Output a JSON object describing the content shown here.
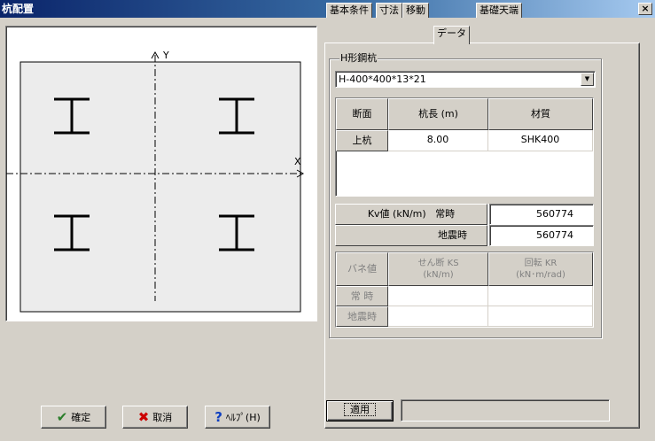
{
  "window": {
    "title": "杭配置",
    "close_glyph": "×"
  },
  "canvas": {
    "axis_y_label": "Y",
    "axis_x_label": "X",
    "background": "#ececec",
    "piles": [
      "I",
      "I",
      "I",
      "I"
    ]
  },
  "tabs": [
    {
      "label": "基本条件",
      "active": false
    },
    {
      "label": "寸法",
      "active": false
    },
    {
      "label": "移動",
      "active": false
    },
    {
      "label": "データ",
      "active": true
    },
    {
      "label": "基礎天端",
      "active": false
    }
  ],
  "group": {
    "label": "H形鋼杭",
    "selected": "H-400*400*13*21"
  },
  "pile_table": {
    "headers": [
      "断面",
      "杭長 (m)",
      "材質"
    ],
    "rows": [
      {
        "name": "上杭",
        "length": "8.00",
        "material": "SHK400"
      }
    ]
  },
  "kv_table": {
    "header": "Kv値 (kN/m)",
    "rows": [
      {
        "label": "常時",
        "value": "560774"
      },
      {
        "label": "地震時",
        "value": "560774"
      }
    ]
  },
  "spring_table": {
    "headers": [
      "バネ値",
      "せん断 KS\n(kN/m)",
      "回転 KR\n(kN･m/rad)"
    ],
    "rows": [
      "常 時",
      "地震時"
    ]
  },
  "buttons": {
    "ok": {
      "label": "確定",
      "icon": "✔",
      "color": "#2a7d2a"
    },
    "cancel": {
      "label": "取消",
      "icon": "✖",
      "color": "#cc0000"
    },
    "help": {
      "label": "ﾍﾙﾌﾟ(H)",
      "icon": "?",
      "color": "#1040c0"
    },
    "apply": {
      "label": "適用"
    }
  }
}
